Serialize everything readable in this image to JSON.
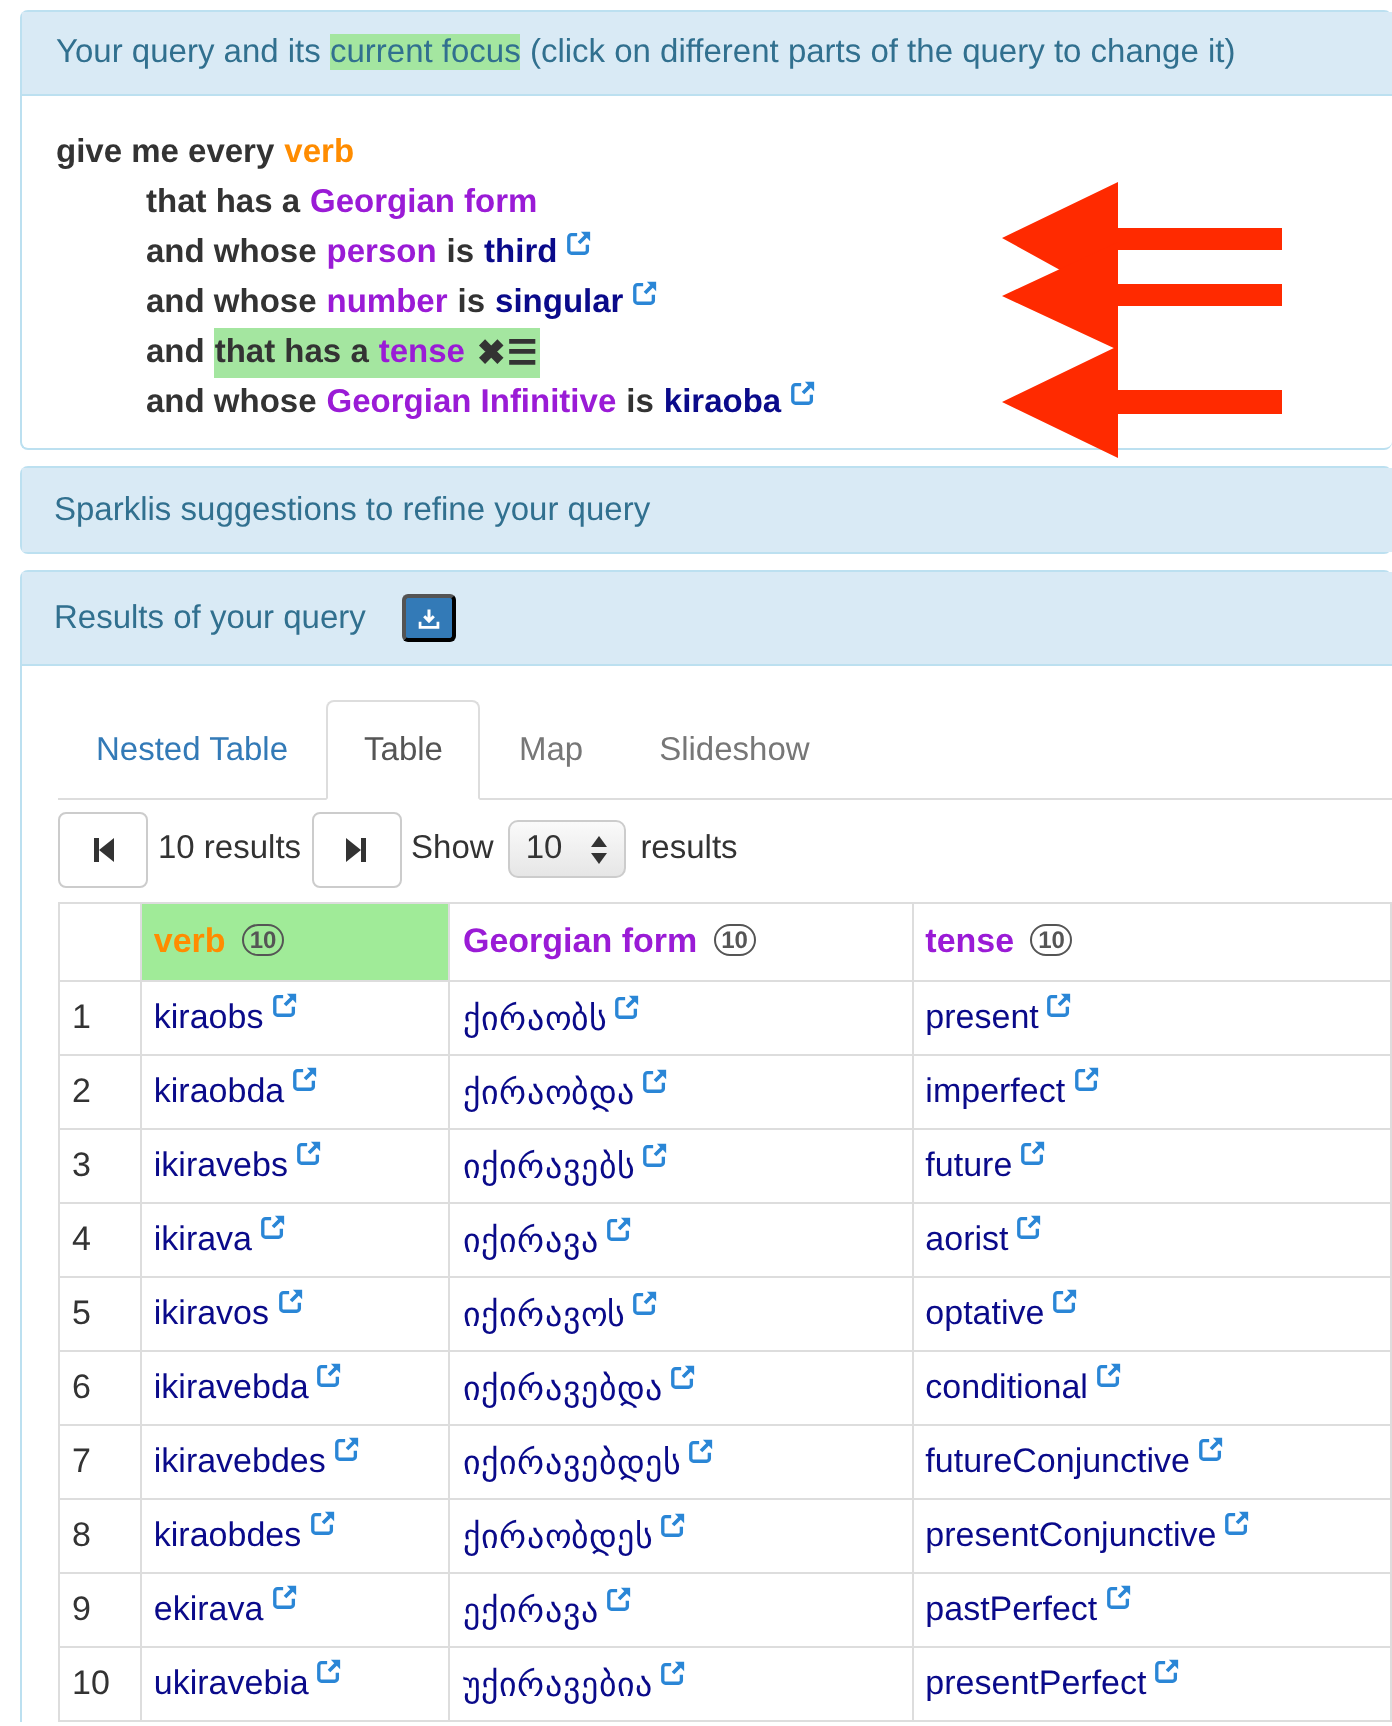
{
  "query_panel": {
    "title": [
      {
        "text": "Your query and its ",
        "highlighted": false
      },
      {
        "text": "current focus",
        "highlighted": true
      },
      {
        "text": " (click on different parts of the query to change it)",
        "highlighted": false
      }
    ],
    "query": {
      "segments": [
        {
          "text": "give me every",
          "kind": "text",
          "focus": false
        },
        {
          "text": "verb",
          "kind": "class",
          "focus": false
        }
      ],
      "link": false,
      "children": [
        {
          "segments": [
            {
              "text": "that has a",
              "kind": "text",
              "focus": false
            },
            {
              "text": "Georgian form",
              "kind": "property",
              "focus": false
            }
          ],
          "link": false
        },
        {
          "segments": [
            {
              "text": "and whose",
              "kind": "text",
              "focus": false
            },
            {
              "text": "person",
              "kind": "property",
              "focus": false
            },
            {
              "text": "is",
              "kind": "text",
              "focus": false
            },
            {
              "text": "third",
              "kind": "entity",
              "focus": false
            }
          ],
          "link": true
        },
        {
          "segments": [
            {
              "text": "and whose",
              "kind": "text",
              "focus": false
            },
            {
              "text": "number",
              "kind": "property",
              "focus": false
            },
            {
              "text": "is",
              "kind": "text",
              "focus": false
            },
            {
              "text": "singular",
              "kind": "entity",
              "focus": false
            }
          ],
          "link": true
        },
        {
          "segments": [
            {
              "text": "and",
              "kind": "text",
              "focus": false
            },
            {
              "text": "that has a",
              "kind": "text",
              "focus": true
            },
            {
              "text": "tense",
              "kind": "property",
              "focus": true
            }
          ],
          "link": false,
          "focus_controls": [
            "✖",
            "☰"
          ]
        },
        {
          "segments": [
            {
              "text": "and whose",
              "kind": "text",
              "focus": false
            },
            {
              "text": "Georgian Infinitive",
              "kind": "property",
              "focus": false
            },
            {
              "text": "is",
              "kind": "text",
              "focus": false
            },
            {
              "text": "kiraoba",
              "kind": "entity",
              "focus": false
            }
          ],
          "link": true
        }
      ]
    }
  },
  "suggestions_panel": {
    "title": "Sparklis suggestions to refine your query"
  },
  "results_panel": {
    "title": "Results of your query",
    "tabs": [
      {
        "label": "Nested Table",
        "selected": false,
        "disabled": false
      },
      {
        "label": "Table",
        "selected": true,
        "disabled": false
      },
      {
        "label": "Map",
        "selected": false,
        "disabled": true
      },
      {
        "label": "Slideshow",
        "selected": false,
        "disabled": true
      }
    ],
    "pager": {
      "count": "10 results",
      "show_label": "Show",
      "page_size": "10",
      "suffix": "results"
    },
    "table": {
      "columns": [
        {
          "label": "verb",
          "kind": "class",
          "count": "10",
          "selected": true
        },
        {
          "label": "Georgian form",
          "kind": "property",
          "count": "10",
          "selected": false
        },
        {
          "label": "tense",
          "kind": "property",
          "count": "10",
          "selected": false
        }
      ],
      "rows": [
        {
          "number": "1",
          "cells": [
            "kiraobs",
            "ქირაობს",
            "present"
          ]
        },
        {
          "number": "2",
          "cells": [
            "kiraobda",
            "ქირაობდა",
            "imperfect"
          ]
        },
        {
          "number": "3",
          "cells": [
            "ikiravebs",
            "იქირავებს",
            "future"
          ]
        },
        {
          "number": "4",
          "cells": [
            "ikirava",
            "იქირავა",
            "aorist"
          ]
        },
        {
          "number": "5",
          "cells": [
            "ikiravos",
            "იქირავოს",
            "optative"
          ]
        },
        {
          "number": "6",
          "cells": [
            "ikiravebda",
            "იქირავებდა",
            "conditional"
          ]
        },
        {
          "number": "7",
          "cells": [
            "ikiravebdes",
            "იქირავებდეს",
            "futureConjunctive"
          ]
        },
        {
          "number": "8",
          "cells": [
            "kiraobdes",
            "ქირაობდეს",
            "presentConjunctive"
          ]
        },
        {
          "number": "9",
          "cells": [
            "ekirava",
            "ექირავა",
            "pastPerfect"
          ]
        },
        {
          "number": "10",
          "cells": [
            "ukiravebia",
            "უქირავებია",
            "presentPerfect"
          ]
        }
      ]
    }
  }
}
